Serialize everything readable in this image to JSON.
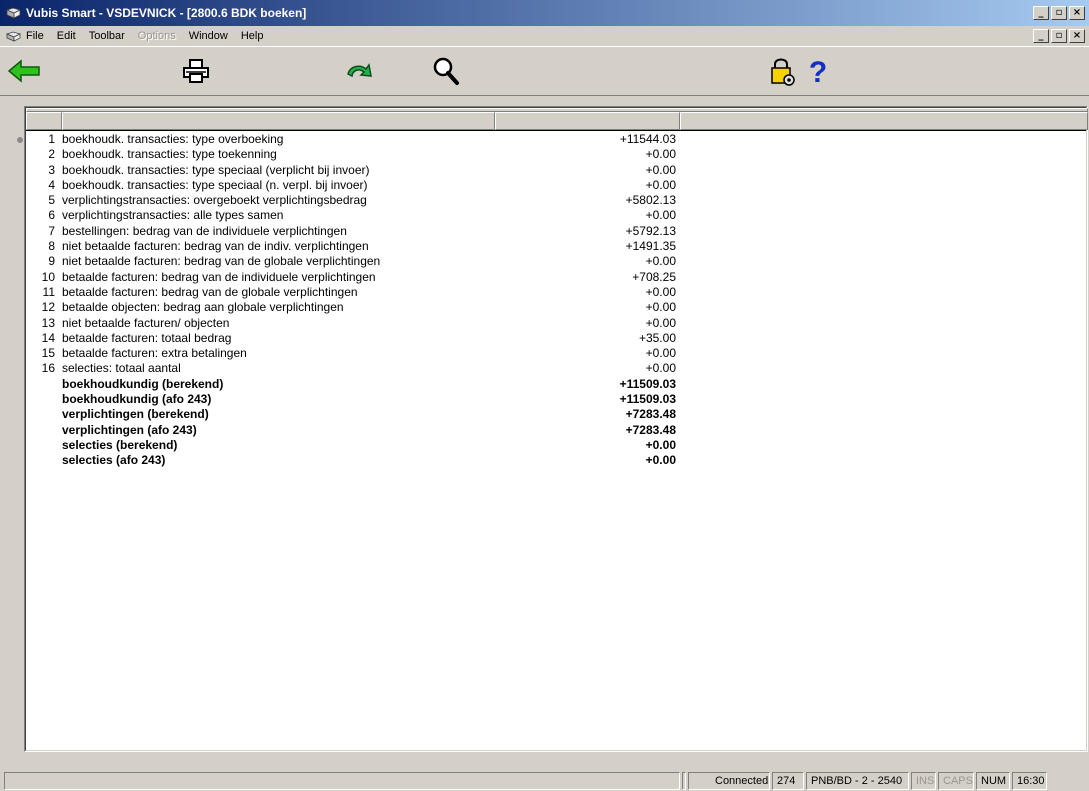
{
  "window": {
    "title": "Vubis Smart - VSDEVNICK - [2800.6 BDK boeken]"
  },
  "menu": [
    "File",
    "Edit",
    "Toolbar",
    "Options",
    "Window",
    "Help"
  ],
  "menu_disabled": [
    "Options"
  ],
  "toolbar": {
    "icons": [
      "back-arrow-icon",
      "printer-icon",
      "redo-arrow-icon",
      "magnifier-icon",
      "lock-gear-icon",
      "help-question-icon"
    ]
  },
  "rows": [
    {
      "num": "1",
      "desc": "boekhoudk. transacties: type overboeking",
      "val": "+11544.03"
    },
    {
      "num": "2",
      "desc": "boekhoudk. transacties: type toekenning",
      "val": "+0.00"
    },
    {
      "num": "3",
      "desc": "boekhoudk. transacties: type speciaal (verplicht bij invoer)",
      "val": "+0.00"
    },
    {
      "num": "4",
      "desc": "boekhoudk. transacties: type speciaal (n. verpl. bij invoer)",
      "val": "+0.00"
    },
    {
      "num": "5",
      "desc": "verplichtingstransacties: overgeboekt verplichtingsbedrag",
      "val": "+5802.13"
    },
    {
      "num": "6",
      "desc": "verplichtingstransacties: alle types samen",
      "val": "+0.00"
    },
    {
      "num": "7",
      "desc": "bestellingen: bedrag van de individuele verplichtingen",
      "val": "+5792.13"
    },
    {
      "num": "8",
      "desc": "niet betaalde facturen: bedrag van de indiv. verplichtingen",
      "val": "+1491.35"
    },
    {
      "num": "9",
      "desc": "niet betaalde facturen: bedrag van de globale verplichtingen",
      "val": "+0.00"
    },
    {
      "num": "10",
      "desc": "betaalde facturen: bedrag van de individuele verplichtingen",
      "val": "+708.25"
    },
    {
      "num": "11",
      "desc": "betaalde facturen: bedrag van de globale verplichtingen",
      "val": "+0.00"
    },
    {
      "num": "12",
      "desc": "betaalde objecten: bedrag aan globale verplichtingen",
      "val": "+0.00"
    },
    {
      "num": "13",
      "desc": "niet betaalde facturen/ objecten",
      "val": "+0.00"
    },
    {
      "num": "14",
      "desc": "betaalde facturen: totaal bedrag",
      "val": "+35.00"
    },
    {
      "num": "15",
      "desc": "betaalde facturen: extra betalingen",
      "val": "+0.00"
    },
    {
      "num": "16",
      "desc": "selecties: totaal aantal",
      "val": "+0.00"
    }
  ],
  "summary_rows": [
    {
      "desc": "boekhoudkundig (berekend)",
      "val": "+11509.03"
    },
    {
      "desc": "boekhoudkundig (afo 243)",
      "val": "+11509.03"
    },
    {
      "desc": "verplichtingen (berekend)",
      "val": "+7283.48"
    },
    {
      "desc": "verplichtingen (afo 243)",
      "val": "+7283.48"
    },
    {
      "desc": "selecties (berekend)",
      "val": "+0.00"
    },
    {
      "desc": "selecties (afo 243)",
      "val": "+0.00"
    }
  ],
  "status": {
    "connection": "Connected",
    "count": "274",
    "location": "PNB/BD - 2 - 2540",
    "ins": "INS",
    "caps": "CAPS",
    "num": "NUM",
    "time": "16:30"
  }
}
